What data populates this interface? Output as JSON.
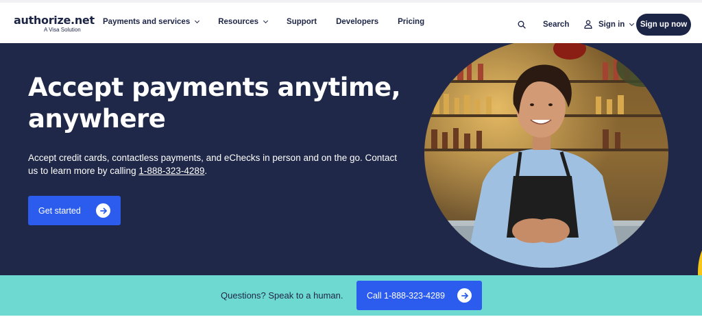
{
  "header": {
    "logo": {
      "wordmark": "authorize.net",
      "tagline": "A Visa Solution"
    },
    "nav": [
      {
        "label": "Payments and services",
        "has_dropdown": true
      },
      {
        "label": "Resources",
        "has_dropdown": true
      },
      {
        "label": "Support",
        "has_dropdown": false
      },
      {
        "label": "Developers",
        "has_dropdown": false
      },
      {
        "label": "Pricing",
        "has_dropdown": false
      }
    ],
    "search_label": "Search",
    "signin_label": "Sign in",
    "signup_label": "Sign up now"
  },
  "hero": {
    "title": "Accept payments anytime, anywhere",
    "subtitle_prefix": "Accept credit cards, contactless payments, and eChecks in person and on the go. Contact us to learn more by calling ",
    "phone": "1-888-323-4289",
    "subtitle_suffix": ".",
    "cta_label": "Get started"
  },
  "banner": {
    "text": "Questions? Speak to a human.",
    "call_label": "Call 1-888-323-4289"
  },
  "colors": {
    "navy": "#1f2848",
    "brand_blue": "#2b5ced",
    "teal": "#6ed9d0",
    "text_dark": "#1d2547"
  },
  "icons": [
    "search-icon",
    "user-icon",
    "chevron-down-icon",
    "arrow-right-icon"
  ]
}
